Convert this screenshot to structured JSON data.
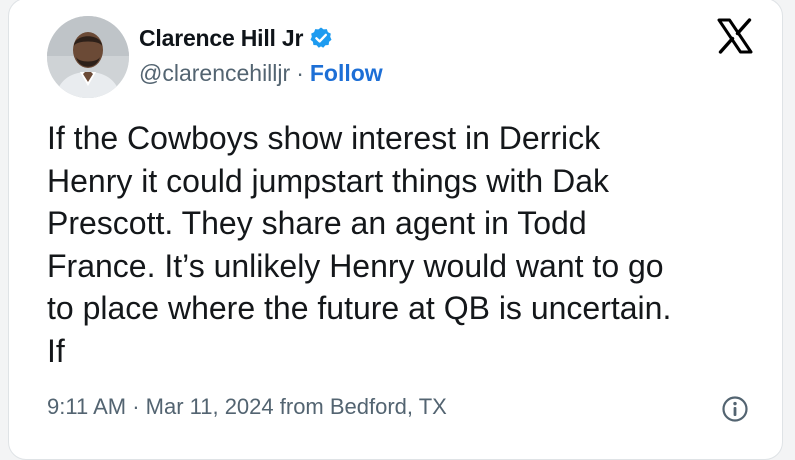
{
  "author": {
    "name": "Clarence Hill Jr",
    "handle": "@clarencehilljr",
    "separator": "·",
    "follow_label": "Follow",
    "verified_badge_color": "#1d9bf0"
  },
  "icons": {
    "verified": "verified-badge-icon",
    "brand": "x-logo-icon",
    "info": "info-icon"
  },
  "tweet": {
    "lines": [
      "If the Cowboys show interest in Derrick",
      "Henry it could jumpstart things with Dak",
      "Prescott. They share an agent in Todd",
      "France. It’s unlikely Henry would want to go",
      "to place where the future at QB is uncertain.",
      "If"
    ]
  },
  "meta": {
    "timestamp": "9:11 AM · Mar 11, 2024 from Bedford, TX"
  },
  "colors": {
    "link": "#1d6fd6",
    "secondary_text": "#536471",
    "primary_text": "#0f1419"
  }
}
